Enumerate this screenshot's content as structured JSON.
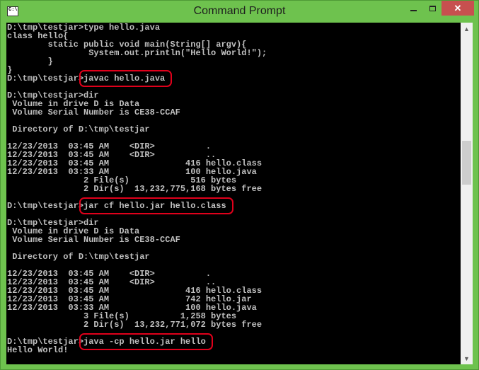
{
  "window": {
    "title": "Command Prompt"
  },
  "icons": {
    "app": "command-prompt-icon",
    "minimize": "minimize-icon",
    "maximize": "maximize-icon",
    "close": "close-icon",
    "scroll_up": "up-arrow-icon",
    "scroll_down": "down-arrow-icon"
  },
  "controls": {
    "close_glyph": "✕",
    "up_glyph": "▲",
    "down_glyph": "▼"
  },
  "colors": {
    "title_bar": "#6ec24e",
    "close_button": "#c7504f",
    "console_bg": "#000000",
    "console_text": "#c0c0c0",
    "highlight": "#e0001b"
  },
  "console": {
    "lines": [
      "D:\\tmp\\testjar>type hello.java",
      "class hello{",
      "        static public void main(String[] argv){",
      "                System.out.println(\"Hello World!\");",
      "        }",
      "}",
      "D:\\tmp\\testjar>javac hello.java",
      "",
      "D:\\tmp\\testjar>dir",
      " Volume in drive D is Data",
      " Volume Serial Number is CE38-CCAF",
      "",
      " Directory of D:\\tmp\\testjar",
      "",
      "12/23/2013  03:45 AM    <DIR>          .",
      "12/23/2013  03:45 AM    <DIR>          ..",
      "12/23/2013  03:45 AM               416 hello.class",
      "12/23/2013  03:33 AM               100 hello.java",
      "               2 File(s)            516 bytes",
      "               2 Dir(s)  13,232,775,168 bytes free",
      "",
      "D:\\tmp\\testjar>jar cf hello.jar hello.class",
      "",
      "D:\\tmp\\testjar>dir",
      " Volume in drive D is Data",
      " Volume Serial Number is CE38-CCAF",
      "",
      " Directory of D:\\tmp\\testjar",
      "",
      "12/23/2013  03:45 AM    <DIR>          .",
      "12/23/2013  03:45 AM    <DIR>          ..",
      "12/23/2013  03:45 AM               416 hello.class",
      "12/23/2013  03:45 AM               742 hello.jar",
      "12/23/2013  03:33 AM               100 hello.java",
      "               3 File(s)          1,258 bytes",
      "               2 Dir(s)  13,232,771,072 bytes free",
      "",
      "D:\\tmp\\testjar>java -cp hello.jar hello",
      "Hello World!"
    ],
    "highlighted_commands": [
      "javac hello.java",
      "jar cf hello.jar hello.class",
      "java -cp hello.jar hello"
    ]
  }
}
